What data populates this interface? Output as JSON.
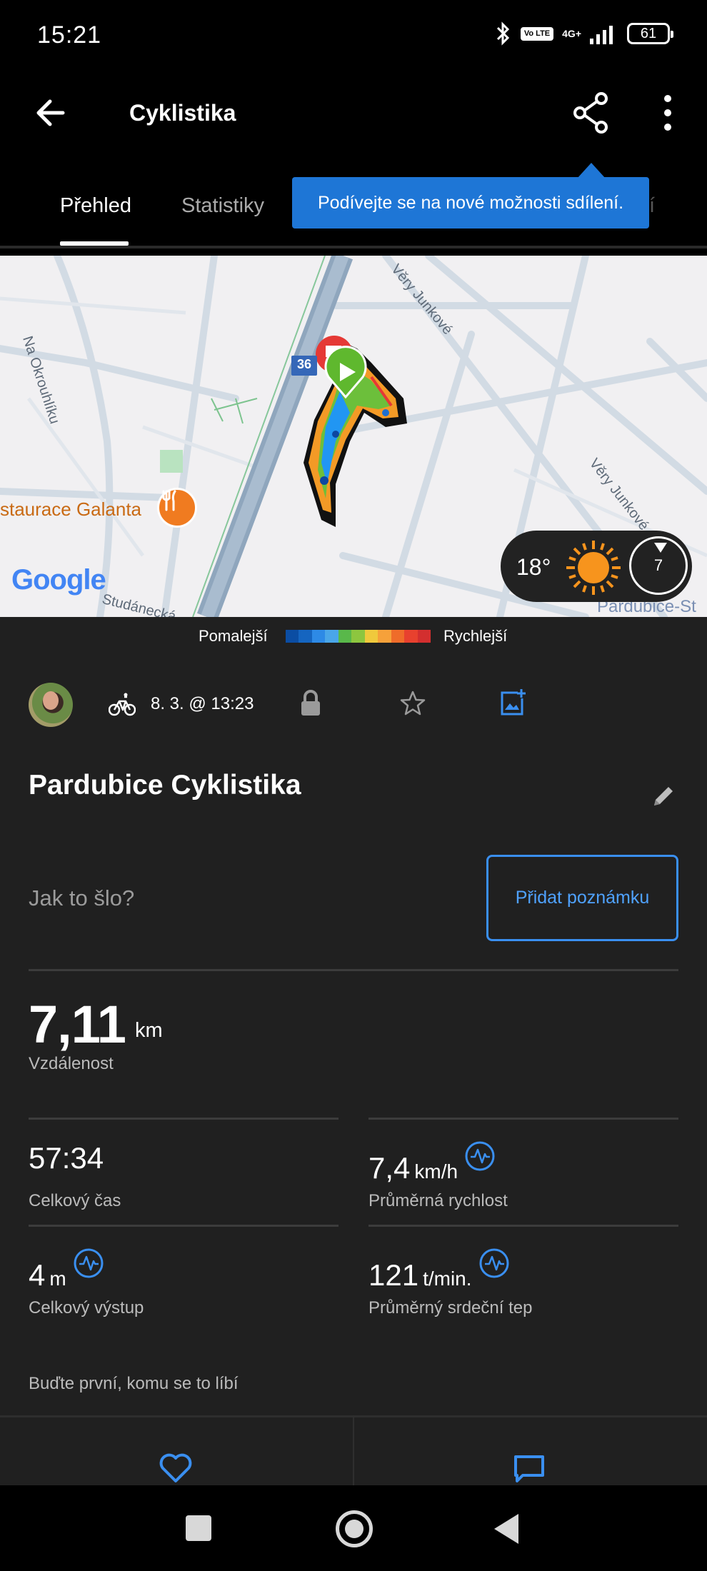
{
  "status_bar": {
    "time": "15:21",
    "volte": "Vo LTE",
    "network": "4G+",
    "battery": "61"
  },
  "app_bar": {
    "title": "Cyklistika"
  },
  "tabs": [
    {
      "label": "Přehled",
      "active": true
    },
    {
      "label": "Statistiky",
      "active": false
    }
  ],
  "tab_partial": "í",
  "tooltip": "Podívejte se na nové možnosti sdílení.",
  "map": {
    "streets": [
      "Na Okrouhlíku",
      "Věry Junkové",
      "Věry Junkové",
      "Studánecká",
      "Pardubice-St"
    ],
    "road_number": "36",
    "poi": "staurace Galanta",
    "google_logo": "Google",
    "accent_route": [
      "#0d47a1",
      "#2196f3",
      "#4caf50",
      "#8bc34a",
      "#ffeb3b",
      "#ff9800",
      "#e53935"
    ]
  },
  "weather": {
    "temp": "18°",
    "wind": "7"
  },
  "legend": {
    "slow": "Pomalejší",
    "fast": "Rychlejší",
    "colors": [
      "#0b4da3",
      "#1565c0",
      "#2d8ae6",
      "#4aa6e8",
      "#59b84a",
      "#8dc63f",
      "#f0c93c",
      "#f6a13a",
      "#ef6c2a",
      "#e8412e",
      "#d32f2f"
    ]
  },
  "activity": {
    "date": "8. 3. @ 13:23",
    "title": "Pardubice Cyklistika",
    "how_prompt": "Jak to šlo?",
    "add_note": "Přidat poznámku",
    "distance": {
      "value": "7,11",
      "unit": "km",
      "label": "Vzdálenost"
    },
    "stats": [
      {
        "value": "57:34",
        "unit": "",
        "label": "Celkový čas",
        "pulse": false
      },
      {
        "value": "7,4",
        "unit": "km/h",
        "label": "Průměrná rychlost",
        "pulse": true
      },
      {
        "value": "4",
        "unit": "m",
        "label": "Celkový výstup",
        "pulse": true
      },
      {
        "value": "121",
        "unit": "t/min.",
        "label": "Průměrný srdeční tep",
        "pulse": true
      }
    ],
    "likes": "Buďte první, komu se to líbí"
  },
  "colors": {
    "accent": "#4fa2ff",
    "tooltip": "#1e76d6",
    "background": "#202020"
  }
}
